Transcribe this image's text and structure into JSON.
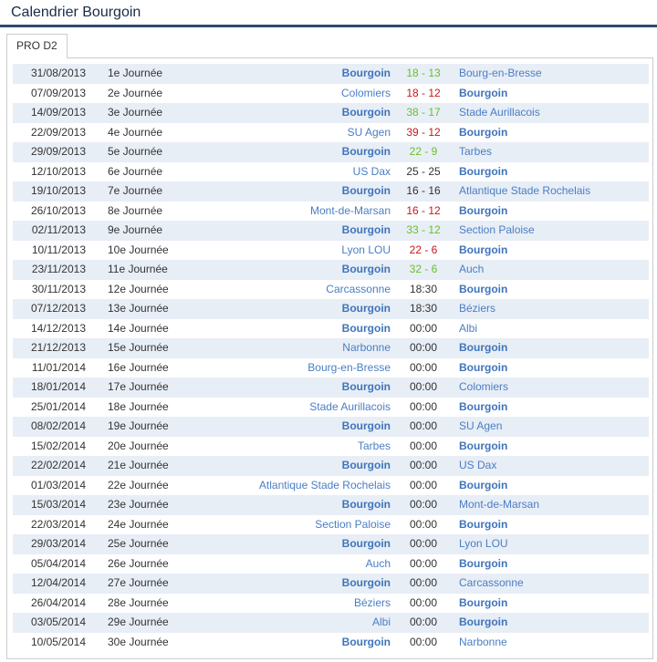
{
  "header": {
    "title": "Calendrier Bourgoin"
  },
  "tabs": [
    {
      "label": "PRO D2"
    }
  ],
  "colors": {
    "team_link": "#4a7ec4",
    "win": "#6bbf2a",
    "loss": "#c8161d",
    "row_alt": "#e8eef6",
    "title_rule": "#2e4a6e"
  },
  "club": "Bourgoin",
  "matches": [
    {
      "date": "31/08/2013",
      "round": "1e Journée",
      "home": "Bourgoin",
      "score": "18 - 13",
      "away": "Bourg-en-Bresse",
      "result": "win"
    },
    {
      "date": "07/09/2013",
      "round": "2e Journée",
      "home": "Colomiers",
      "score": "18 - 12",
      "away": "Bourgoin",
      "result": "loss"
    },
    {
      "date": "14/09/2013",
      "round": "3e Journée",
      "home": "Bourgoin",
      "score": "38 - 17",
      "away": "Stade Aurillacois",
      "result": "win"
    },
    {
      "date": "22/09/2013",
      "round": "4e Journée",
      "home": "SU Agen",
      "score": "39 - 12",
      "away": "Bourgoin",
      "result": "loss"
    },
    {
      "date": "29/09/2013",
      "round": "5e Journée",
      "home": "Bourgoin",
      "score": "22 - 9",
      "away": "Tarbes",
      "result": "win"
    },
    {
      "date": "12/10/2013",
      "round": "6e Journée",
      "home": "US Dax",
      "score": "25 - 25",
      "away": "Bourgoin",
      "result": "draw"
    },
    {
      "date": "19/10/2013",
      "round": "7e Journée",
      "home": "Bourgoin",
      "score": "16 - 16",
      "away": "Atlantique Stade Rochelais",
      "result": "draw"
    },
    {
      "date": "26/10/2013",
      "round": "8e Journée",
      "home": "Mont-de-Marsan",
      "score": "16 - 12",
      "away": "Bourgoin",
      "result": "loss"
    },
    {
      "date": "02/11/2013",
      "round": "9e Journée",
      "home": "Bourgoin",
      "score": "33 - 12",
      "away": "Section Paloise",
      "result": "win"
    },
    {
      "date": "10/11/2013",
      "round": "10e Journée",
      "home": "Lyon LOU",
      "score": "22 - 6",
      "away": "Bourgoin",
      "result": "loss"
    },
    {
      "date": "23/11/2013",
      "round": "11e Journée",
      "home": "Bourgoin",
      "score": "32 - 6",
      "away": "Auch",
      "result": "win"
    },
    {
      "date": "30/11/2013",
      "round": "12e Journée",
      "home": "Carcassonne",
      "score": "18:30",
      "away": "Bourgoin",
      "result": "none"
    },
    {
      "date": "07/12/2013",
      "round": "13e Journée",
      "home": "Bourgoin",
      "score": "18:30",
      "away": "Béziers",
      "result": "none"
    },
    {
      "date": "14/12/2013",
      "round": "14e Journée",
      "home": "Bourgoin",
      "score": "00:00",
      "away": "Albi",
      "result": "none"
    },
    {
      "date": "21/12/2013",
      "round": "15e Journée",
      "home": "Narbonne",
      "score": "00:00",
      "away": "Bourgoin",
      "result": "none"
    },
    {
      "date": "11/01/2014",
      "round": "16e Journée",
      "home": "Bourg-en-Bresse",
      "score": "00:00",
      "away": "Bourgoin",
      "result": "none"
    },
    {
      "date": "18/01/2014",
      "round": "17e Journée",
      "home": "Bourgoin",
      "score": "00:00",
      "away": "Colomiers",
      "result": "none"
    },
    {
      "date": "25/01/2014",
      "round": "18e Journée",
      "home": "Stade Aurillacois",
      "score": "00:00",
      "away": "Bourgoin",
      "result": "none"
    },
    {
      "date": "08/02/2014",
      "round": "19e Journée",
      "home": "Bourgoin",
      "score": "00:00",
      "away": "SU Agen",
      "result": "none"
    },
    {
      "date": "15/02/2014",
      "round": "20e Journée",
      "home": "Tarbes",
      "score": "00:00",
      "away": "Bourgoin",
      "result": "none"
    },
    {
      "date": "22/02/2014",
      "round": "21e Journée",
      "home": "Bourgoin",
      "score": "00:00",
      "away": "US Dax",
      "result": "none"
    },
    {
      "date": "01/03/2014",
      "round": "22e Journée",
      "home": "Atlantique Stade Rochelais",
      "score": "00:00",
      "away": "Bourgoin",
      "result": "none"
    },
    {
      "date": "15/03/2014",
      "round": "23e Journée",
      "home": "Bourgoin",
      "score": "00:00",
      "away": "Mont-de-Marsan",
      "result": "none"
    },
    {
      "date": "22/03/2014",
      "round": "24e Journée",
      "home": "Section Paloise",
      "score": "00:00",
      "away": "Bourgoin",
      "result": "none"
    },
    {
      "date": "29/03/2014",
      "round": "25e Journée",
      "home": "Bourgoin",
      "score": "00:00",
      "away": "Lyon LOU",
      "result": "none"
    },
    {
      "date": "05/04/2014",
      "round": "26e Journée",
      "home": "Auch",
      "score": "00:00",
      "away": "Bourgoin",
      "result": "none"
    },
    {
      "date": "12/04/2014",
      "round": "27e Journée",
      "home": "Bourgoin",
      "score": "00:00",
      "away": "Carcassonne",
      "result": "none"
    },
    {
      "date": "26/04/2014",
      "round": "28e Journée",
      "home": "Béziers",
      "score": "00:00",
      "away": "Bourgoin",
      "result": "none"
    },
    {
      "date": "03/05/2014",
      "round": "29e Journée",
      "home": "Albi",
      "score": "00:00",
      "away": "Bourgoin",
      "result": "none"
    },
    {
      "date": "10/05/2014",
      "round": "30e Journée",
      "home": "Bourgoin",
      "score": "00:00",
      "away": "Narbonne",
      "result": "none"
    }
  ]
}
